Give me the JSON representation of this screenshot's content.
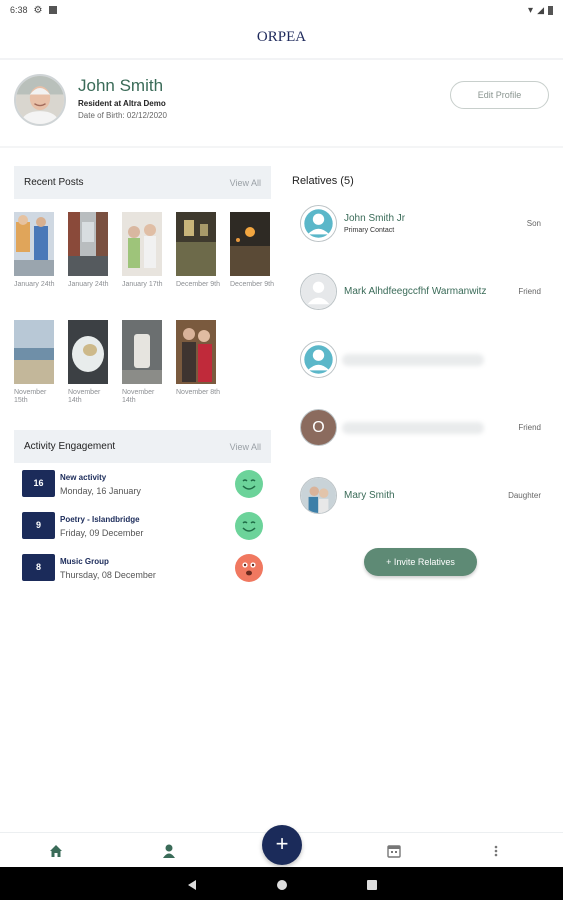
{
  "status_bar": {
    "time": "6:38"
  },
  "brand": {
    "logo_text": "ORPEA"
  },
  "profile": {
    "name": "John Smith",
    "subtitle": "Resident at Altra Demo",
    "dob": "Date of Birth: 02/12/2020",
    "edit_label": "Edit Profile"
  },
  "recent_posts": {
    "title": "Recent Posts",
    "view_all": "View All",
    "posts": [
      {
        "date": "January 24th"
      },
      {
        "date": "January 24th"
      },
      {
        "date": "January 17th"
      },
      {
        "date": "December 9th"
      },
      {
        "date": "December 9th"
      },
      {
        "date": "November 15th"
      },
      {
        "date": "November 14th"
      },
      {
        "date": "November 14th"
      },
      {
        "date": "November 8th"
      }
    ]
  },
  "activity": {
    "title": "Activity Engagement",
    "view_all": "View All",
    "items": [
      {
        "day": "16",
        "title": "New activity",
        "date": "Monday, 16 January",
        "mood": "happy",
        "color": "#6cd39a"
      },
      {
        "day": "9",
        "title": "Poetry - Islandbridge",
        "date": "Friday, 09 December",
        "mood": "happy",
        "color": "#6cd39a"
      },
      {
        "day": "8",
        "title": "Music Group",
        "date": "Thursday, 08 December",
        "mood": "surprised",
        "color": "#f07860"
      }
    ]
  },
  "relatives": {
    "title": "Relatives (5)",
    "items": [
      {
        "name": "John Smith Jr",
        "sub": "Primary Contact",
        "role": "Son",
        "avatar": "generic-teal"
      },
      {
        "name": "Mark Alhdfeegccfhf Warmanwitz",
        "sub": "",
        "role": "Friend",
        "avatar": "generic-grey"
      },
      {
        "name": "",
        "sub": "",
        "role": "",
        "avatar": "generic-teal"
      },
      {
        "name": "",
        "sub": "",
        "role": "Friend",
        "avatar": "letter",
        "initial": "O"
      },
      {
        "name": "Mary Smith",
        "sub": "",
        "role": "Daughter",
        "avatar": "photo"
      }
    ],
    "invite_label": "+ Invite Relatives"
  },
  "bottom_nav": {
    "items": [
      "home-icon",
      "person-icon",
      "add-icon",
      "calendar-icon",
      "more-icon"
    ],
    "fab_label": "+"
  },
  "colors": {
    "brand_green": "#3a6b58",
    "navy": "#1b2b5a",
    "button_green": "#5e8a75"
  }
}
